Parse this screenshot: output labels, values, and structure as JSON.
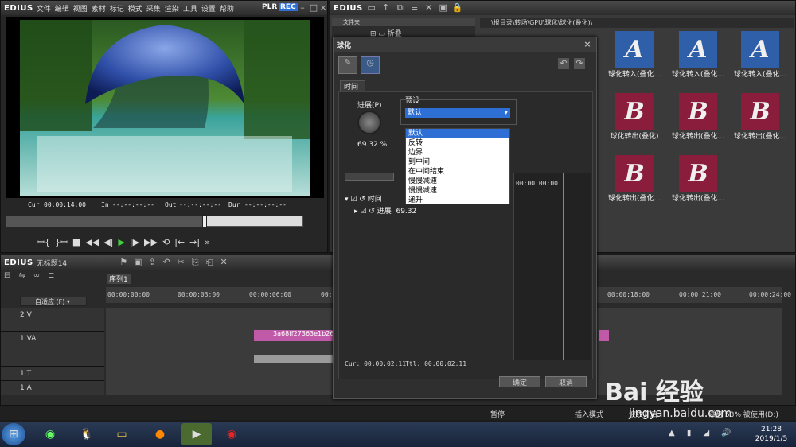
{
  "app": {
    "logo": "EDIUS",
    "menu": [
      "文件",
      "编辑",
      "视图",
      "素材",
      "标记",
      "模式",
      "采集",
      "渲染",
      "工具",
      "设置",
      "帮助"
    ],
    "plr": "PLR",
    "rec": "REC"
  },
  "player": {
    "cur_label": "Cur",
    "cur": "00:00:14:00",
    "in_label": "In",
    "in": "--:--:--:--",
    "out_label": "Out",
    "out": "--:--:--:--",
    "dur_label": "Dur",
    "dur": "--:--:--:--",
    "position": 0.67
  },
  "bin": {
    "logo": "EDIUS",
    "folder_header": "文件夹",
    "folder_item": "折叠",
    "path": "\\根目录\\转场\\GPU\\球化\\球化(叠化)\\",
    "clips": [
      {
        "letter": "A",
        "label": "球化转入(叠化..."
      },
      {
        "letter": "A",
        "label": "球化转入(叠化..."
      },
      {
        "letter": "A",
        "label": "球化转入(叠化..."
      },
      {
        "letter": "B",
        "label": "球化转出(叠化)"
      },
      {
        "letter": "B",
        "label": "球化转出(叠化..."
      },
      {
        "letter": "B",
        "label": "球化转出(叠化..."
      },
      {
        "letter": "B",
        "label": "球化转出(叠化..."
      },
      {
        "letter": "B",
        "label": "球化转出(叠化..."
      }
    ]
  },
  "timeline": {
    "logo": "EDIUS",
    "project": "无标题14",
    "sequence_tab": "序列1",
    "mode": "自适应 (F)",
    "ticks": [
      "00:00:00:00",
      "00:00:03:00",
      "00:00:06:00",
      "00:00:09:00",
      "00:00:18:00",
      "00:00:21:00",
      "00:00:24:00"
    ],
    "tracks": [
      {
        "name": "2 V"
      },
      {
        "name": "1 VA"
      },
      {
        "name": "1 T"
      },
      {
        "name": "1 A"
      }
    ],
    "clip_name": "3a68ff27363e1b26"
  },
  "dialog": {
    "title": "球化",
    "tab": "时间",
    "progress_label": "进展(P)",
    "progress_value": "69.32 %",
    "preset_label": "预设",
    "preset_selected": "默认",
    "options": [
      "默认",
      "反转",
      "边界",
      "到中间",
      "在中间结束",
      "慢慢减速",
      "慢慢减速",
      "递升"
    ],
    "tree_node": "时间",
    "param_name": "进展",
    "param_value": "69.32",
    "ruler_tc": "00:00:00:00",
    "cur": "Cur: 00:00:02:11",
    "ttl": "Ttl: 00:00:02:11",
    "ok": "确定",
    "cancel": "取消"
  },
  "status": {
    "pause": "暂停",
    "insert": "插入模式",
    "wave": "波纹开启",
    "disk": "磁盘:53% 被使用(D:)"
  },
  "taskbar": {
    "time": "21:28",
    "date": "2019/1/5"
  },
  "watermark": {
    "brand": "Bai 经验",
    "url": "jingyan.baidu.com"
  },
  "colors": {
    "accent": "#2e6fd6",
    "dialog_title": "#d0d0d0",
    "clip_pink": "#c05aa8",
    "clip_gray": "#9a9a9a"
  }
}
